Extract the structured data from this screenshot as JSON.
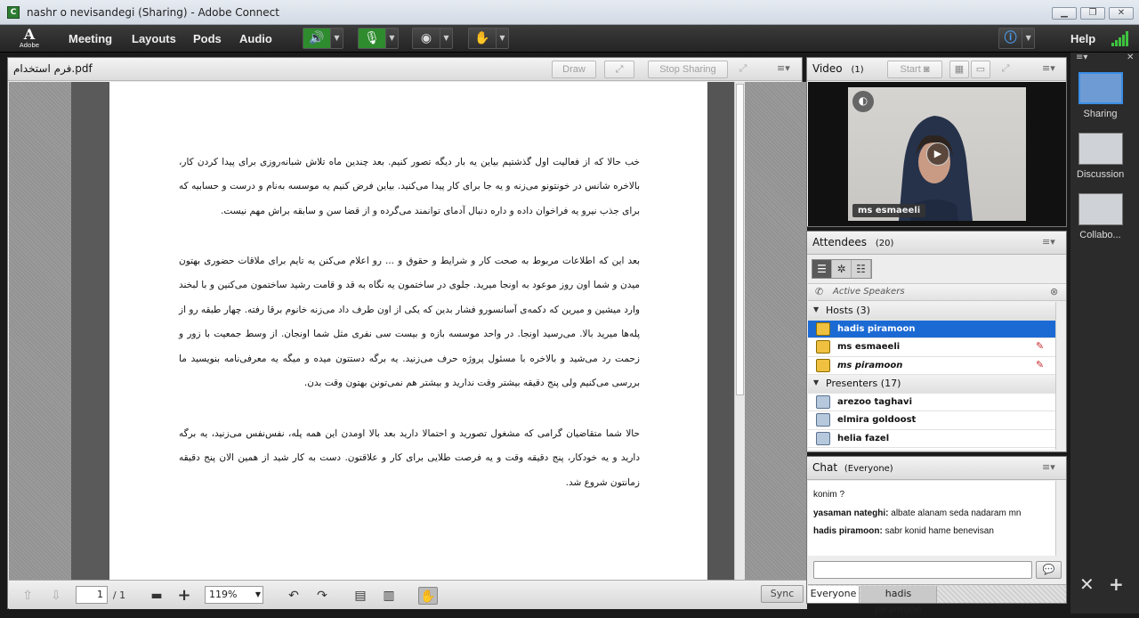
{
  "window": {
    "title": "nashr o nevisandegi (Sharing) - Adobe Connect",
    "controls": [
      "▁",
      "❐",
      "✕"
    ]
  },
  "menubar": {
    "logo": {
      "mark": "A",
      "text": "Adobe"
    },
    "items": [
      "Meeting",
      "Layouts",
      "Pods",
      "Audio"
    ],
    "help": "Help"
  },
  "share_pod": {
    "title": "فرم استخدام.pdf",
    "draw": "Draw",
    "stop_sharing": "Stop Sharing",
    "paragraphs": [
      "خب حالا که از فعالیت اول گذشتیم بیاین یه بار دیگه تصور کنیم. بعد چندین ماه تلاش شبانه‌روزی برای پیدا کردن کار، بالاخره شانس در خونتونو می‌زنه و یه جا برای کار پیدا می‌کنید. بیاین فرض کنیم یه موسسه به‌نام و درست و حسابیه که برای جذب نیرو یه فراخوان داده و داره دنبال آدمای توانمند می‌گرده و از قضا سن و سابقه براش مهم نیست.",
      "بعد این که اطلاعات مربوط به صحت کار و شرایط و حقوق و ... رو اعلام می‌کنن یه تایم برای ملاقات حضوری بهتون میدن و شما اون روز موعود به اونجا میرید. جلوی در ساختمون یه نگاه به قد و قامت رشید ساختمون می‌کنین و با لبخند وارد میشین و میرین که دکمه‌ی آسانسورو فشار بدین که یکی از اون طرف داد می‌زنه خانوم برقا رفته. چهار طبقه رو از پله‌ها میرید بالا. می‌رسید اونجا. در واحد موسسه بازه و بیست سی نفری مثل شما اونجان. از وسط جمعیت با زور و زحمت رد می‌شید و بالاخره با مسئول پروژه حرف می‌زنید. یه برگه دستتون میده و میگه یه معرفی‌نامه بنویسید ما بررسی می‌کنیم ولی پنج دقیقه بیشتر وقت ندارید و بیشتر هم نمی‌تونن بهتون وقت بدن.",
      "حالا شما متقاضیان گرامی که مشغول تصورید و احتمالا دارید بعد بالا اومدن این همه پله، نفس‌نفس می‌زنید، یه برگه دارید و یه خودکار، پنج دقیقه وقت و یه فرصت طلایی برای کار و علاقتون. دست به کار شید از همین الان پنج دقیقه زمانتون شروع شد."
    ],
    "page_current": "1",
    "page_total": "/ 1",
    "zoom": "119%",
    "sync": "Sync"
  },
  "video_pod": {
    "title": "Video",
    "count": "(1)",
    "start": "Start",
    "speaker_name": "ms esmaeeli"
  },
  "attendees_pod": {
    "title": "Attendees",
    "count": "(20)",
    "active_speakers": "Active Speakers",
    "hosts_label": "Hosts (3)",
    "hosts": [
      "hadis piramoon",
      "ms esmaeeli",
      "ms piramoon"
    ],
    "presenters_label": "Presenters (17)",
    "presenters": [
      "arezoo taghavi",
      "elmira goldoost",
      "helia fazel"
    ]
  },
  "chat_pod": {
    "title": "Chat",
    "scope": "(Everyone)",
    "messages": [
      {
        "sender": "",
        "text": "konim ?"
      },
      {
        "sender": "yasaman nateghi:",
        "text": "albate alanam seda nadaram mn"
      },
      {
        "sender": "hadis piramoon:",
        "text": "sabr konid hame benevisan"
      }
    ],
    "tabs": [
      "Everyone",
      "hadis piramoon"
    ]
  },
  "layouts": [
    "Sharing",
    "Discussion",
    "Collabo..."
  ],
  "colors": {
    "selection": "#1b6ad4",
    "accent_green": "#3ec43e",
    "layout_active": "#3a8ee6"
  }
}
